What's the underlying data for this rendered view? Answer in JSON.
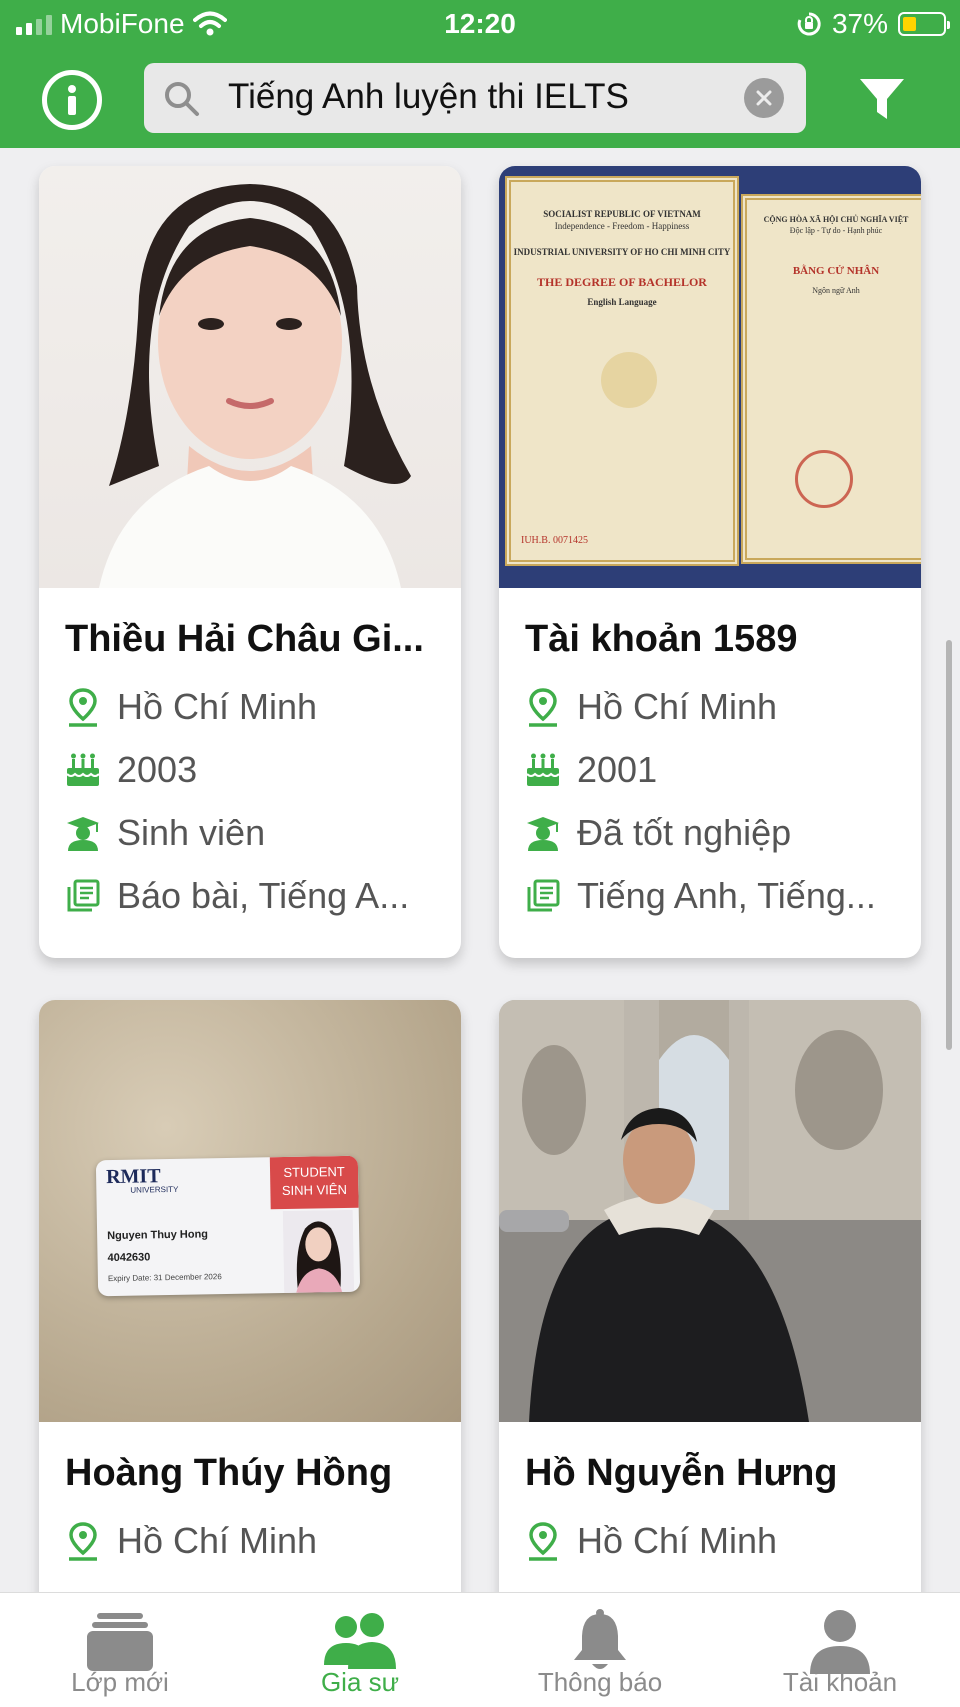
{
  "status_bar": {
    "carrier": "MobiFone",
    "time": "12:20",
    "battery": "37%",
    "battery_level": 0.37
  },
  "header": {
    "search_value": "Tiếng Anh luyện thi IELTS",
    "icons": [
      "info-icon",
      "search-icon",
      "clear-icon",
      "filter-icon"
    ]
  },
  "tutors": [
    {
      "name": "Thiều Hải Châu Gi...",
      "location": "Hồ Chí Minh",
      "birth_year": "2003",
      "status": "Sinh viên",
      "subjects": "Báo bài, Tiếng A...",
      "photo": "portrait"
    },
    {
      "name": "Tài khoản 1589",
      "location": "Hồ Chí Minh",
      "birth_year": "2001",
      "status": "Đã tốt nghiệp",
      "subjects": "Tiếng Anh, Tiếng...",
      "photo": "diploma",
      "diploma": {
        "left_country": "SOCIALIST REPUBLIC OF VIETNAM",
        "left_motto": "Independence - Freedom - Happiness",
        "left_school": "INDUSTRIAL UNIVERSITY OF HO CHI MINH CITY",
        "left_degree": "THE DEGREE OF BACHELOR",
        "left_major": "English Language",
        "right_country": "CỘNG HÒA XÃ HỘI CHỦ NGHĨA VIỆT",
        "right_motto": "Độc lập - Tự do - Hạnh phúc",
        "right_degree": "BẰNG CỬ NHÂN",
        "right_major": "Ngôn ngữ Anh",
        "serial": "IUH.B. 0071425"
      }
    },
    {
      "name": "Hoàng Thúy Hồng",
      "location": "Hồ Chí Minh",
      "photo": "student-card",
      "card": {
        "university": "RMIT",
        "university_sub": "UNIVERSITY",
        "badge_line1": "STUDENT",
        "badge_line2": "SINH VIÊN",
        "holder": "Nguyen Thuy Hong",
        "number": "4042630",
        "expiry": "Expiry Date: 31 December 2026"
      }
    },
    {
      "name": "Hồ Nguyễn Hưng",
      "location": "Hồ Chí Minh",
      "photo": "paris"
    }
  ],
  "tabs": [
    {
      "label": "Lớp mới",
      "icon": "classes-icon",
      "active": false
    },
    {
      "label": "Gia sư",
      "icon": "tutors-icon",
      "active": true
    },
    {
      "label": "Thông báo",
      "icon": "bell-icon",
      "active": false
    },
    {
      "label": "Tài khoản",
      "icon": "account-icon",
      "active": false
    }
  ],
  "colors": {
    "primary_green": "#3fae49",
    "background": "#efeff1",
    "inactive_tab": "#8b8b8b"
  }
}
